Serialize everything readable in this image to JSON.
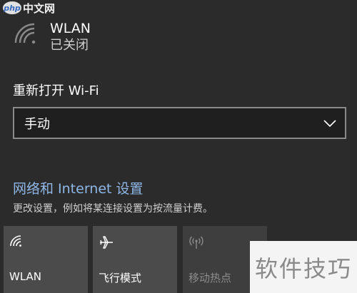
{
  "watermark": {
    "logo_text": "php",
    "site": "中文网"
  },
  "wlan": {
    "title": "WLAN",
    "status": "已关闭"
  },
  "reopen": {
    "label": "重新打开 Wi-Fi",
    "selected_option": "手动"
  },
  "network_settings": {
    "link": "网络和 Internet 设置",
    "description": "更改设置，例如将某连接设置为按流量计费。"
  },
  "quick_actions": [
    {
      "label": "WLAN",
      "icon": "wifi-icon",
      "enabled": true
    },
    {
      "label": "飞行模式",
      "icon": "airplane-icon",
      "enabled": true
    },
    {
      "label": "移动热点",
      "icon": "hotspot-icon",
      "enabled": false
    }
  ],
  "brand_overlay": "软件技巧",
  "colors": {
    "background": "#2b2b2b",
    "link": "#8fb8e8",
    "tile": "#4b4b4b"
  }
}
